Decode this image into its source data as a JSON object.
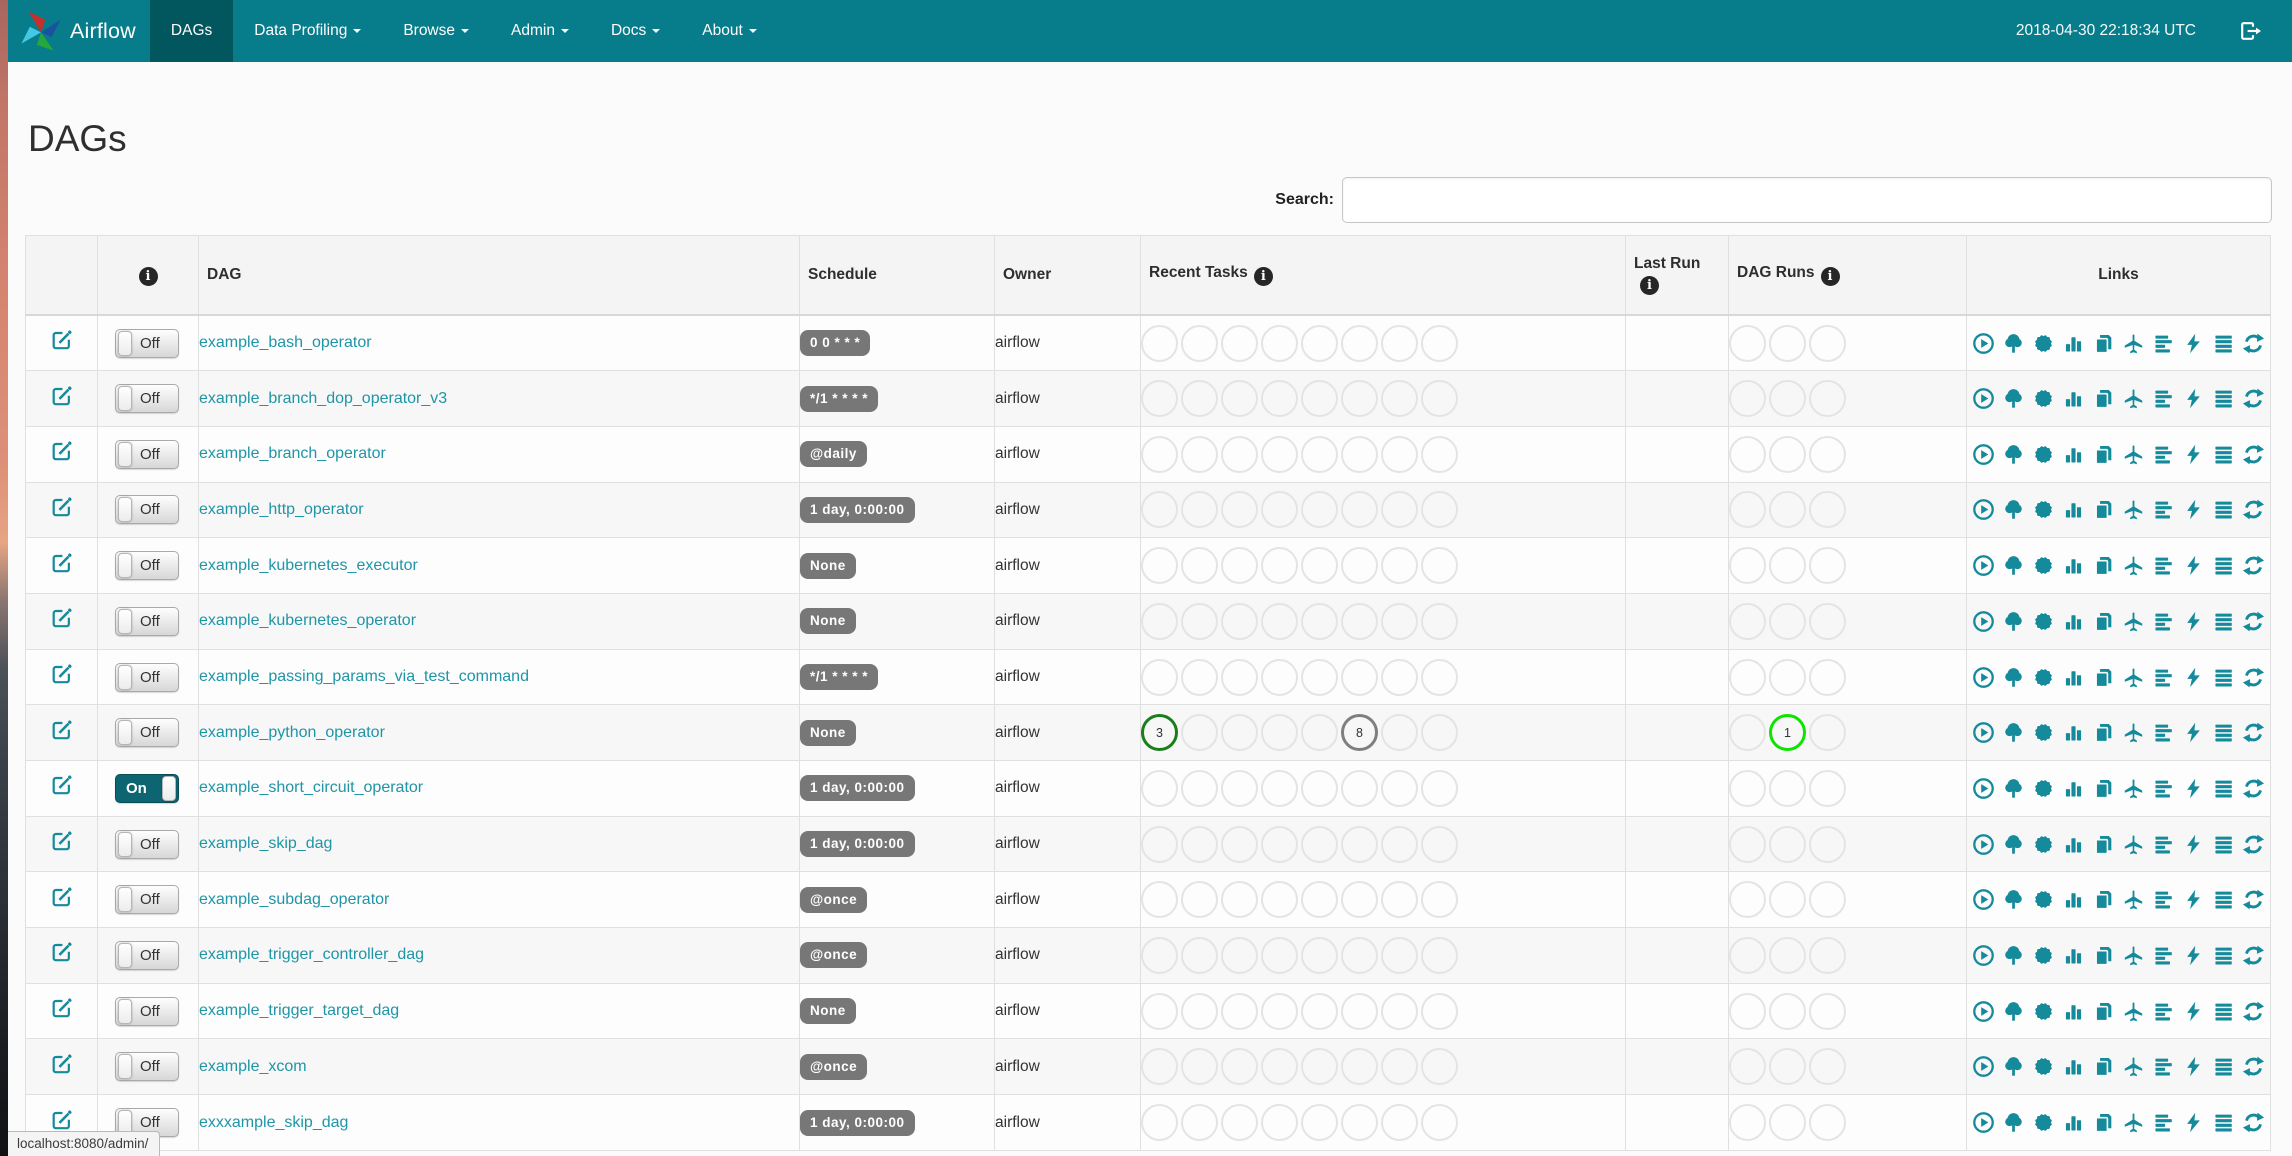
{
  "navbar": {
    "brand": "Airflow",
    "items": [
      {
        "label": "DAGs",
        "active": true,
        "dropdown": false
      },
      {
        "label": "Data Profiling",
        "active": false,
        "dropdown": true
      },
      {
        "label": "Browse",
        "active": false,
        "dropdown": true
      },
      {
        "label": "Admin",
        "active": false,
        "dropdown": true
      },
      {
        "label": "Docs",
        "active": false,
        "dropdown": true
      },
      {
        "label": "About",
        "active": false,
        "dropdown": true
      }
    ],
    "timestamp": "2018-04-30 22:18:34 UTC",
    "logout_icon": "log-out-icon"
  },
  "page": {
    "title": "DAGs",
    "status_bar": "localhost:8080/admin/"
  },
  "search": {
    "label": "Search:",
    "value": ""
  },
  "table": {
    "headers": {
      "edit": "",
      "info_icon": "info-icon",
      "dag": "DAG",
      "schedule": "Schedule",
      "owner": "Owner",
      "recent_tasks": "Recent Tasks",
      "last_run": "Last Run",
      "dag_runs": "DAG Runs",
      "links": "Links"
    },
    "recent_task_slots": 8,
    "dag_run_slots": 3,
    "links_icons": [
      "trigger-dag-icon",
      "tree-view-icon",
      "graph-view-icon",
      "task-duration-icon",
      "task-tries-icon",
      "landing-times-icon",
      "gantt-icon",
      "code-icon",
      "logs-icon",
      "refresh-icon"
    ],
    "rows": [
      {
        "dag": "example_bash_operator",
        "toggle": "Off",
        "schedule": "0 0 * * *",
        "owner": "airflow",
        "last_run": "",
        "recent_tasks": [],
        "dag_runs": []
      },
      {
        "dag": "example_branch_dop_operator_v3",
        "toggle": "Off",
        "schedule": "*/1 * * * *",
        "owner": "airflow",
        "last_run": "",
        "recent_tasks": [],
        "dag_runs": []
      },
      {
        "dag": "example_branch_operator",
        "toggle": "Off",
        "schedule": "@daily",
        "owner": "airflow",
        "last_run": "",
        "recent_tasks": [],
        "dag_runs": []
      },
      {
        "dag": "example_http_operator",
        "toggle": "Off",
        "schedule": "1 day, 0:00:00",
        "owner": "airflow",
        "last_run": "",
        "recent_tasks": [],
        "dag_runs": []
      },
      {
        "dag": "example_kubernetes_executor",
        "toggle": "Off",
        "schedule": "None",
        "owner": "airflow",
        "last_run": "",
        "recent_tasks": [],
        "dag_runs": []
      },
      {
        "dag": "example_kubernetes_operator",
        "toggle": "Off",
        "schedule": "None",
        "owner": "airflow",
        "last_run": "",
        "recent_tasks": [],
        "dag_runs": []
      },
      {
        "dag": "example_passing_params_via_test_command",
        "toggle": "Off",
        "schedule": "*/1 * * * *",
        "owner": "airflow",
        "last_run": "",
        "recent_tasks": [],
        "dag_runs": []
      },
      {
        "dag": "example_python_operator",
        "toggle": "Off",
        "schedule": "None",
        "owner": "airflow",
        "last_run": "",
        "recent_tasks": [
          {
            "slot": 0,
            "count": "3",
            "state": "success"
          },
          {
            "slot": 5,
            "count": "8",
            "state": "queued"
          }
        ],
        "dag_runs": [
          {
            "slot": 1,
            "count": "1",
            "state": "running"
          }
        ]
      },
      {
        "dag": "example_short_circuit_operator",
        "toggle": "On",
        "schedule": "1 day, 0:00:00",
        "owner": "airflow",
        "last_run": "",
        "recent_tasks": [],
        "dag_runs": []
      },
      {
        "dag": "example_skip_dag",
        "toggle": "Off",
        "schedule": "1 day, 0:00:00",
        "owner": "airflow",
        "last_run": "",
        "recent_tasks": [],
        "dag_runs": []
      },
      {
        "dag": "example_subdag_operator",
        "toggle": "Off",
        "schedule": "@once",
        "owner": "airflow",
        "last_run": "",
        "recent_tasks": [],
        "dag_runs": []
      },
      {
        "dag": "example_trigger_controller_dag",
        "toggle": "Off",
        "schedule": "@once",
        "owner": "airflow",
        "last_run": "",
        "recent_tasks": [],
        "dag_runs": []
      },
      {
        "dag": "example_trigger_target_dag",
        "toggle": "Off",
        "schedule": "None",
        "owner": "airflow",
        "last_run": "",
        "recent_tasks": [],
        "dag_runs": []
      },
      {
        "dag": "example_xcom",
        "toggle": "Off",
        "schedule": "@once",
        "owner": "airflow",
        "last_run": "",
        "recent_tasks": [],
        "dag_runs": []
      },
      {
        "dag": "exxxample_skip_dag",
        "toggle": "Off",
        "schedule": "1 day, 0:00:00",
        "owner": "airflow",
        "last_run": "",
        "recent_tasks": [],
        "dag_runs": []
      }
    ]
  },
  "colors": {
    "navbar": "#077c8a",
    "navbar_active": "#02565e",
    "accent_icon": "#148a9b",
    "dag_link": "#1f95a5",
    "badge_bg": "#777777",
    "state_success": "#1b7e1b",
    "state_running": "#0fe300",
    "state_queued": "#7f7f7f",
    "empty_circle": "#e4e4e4"
  }
}
